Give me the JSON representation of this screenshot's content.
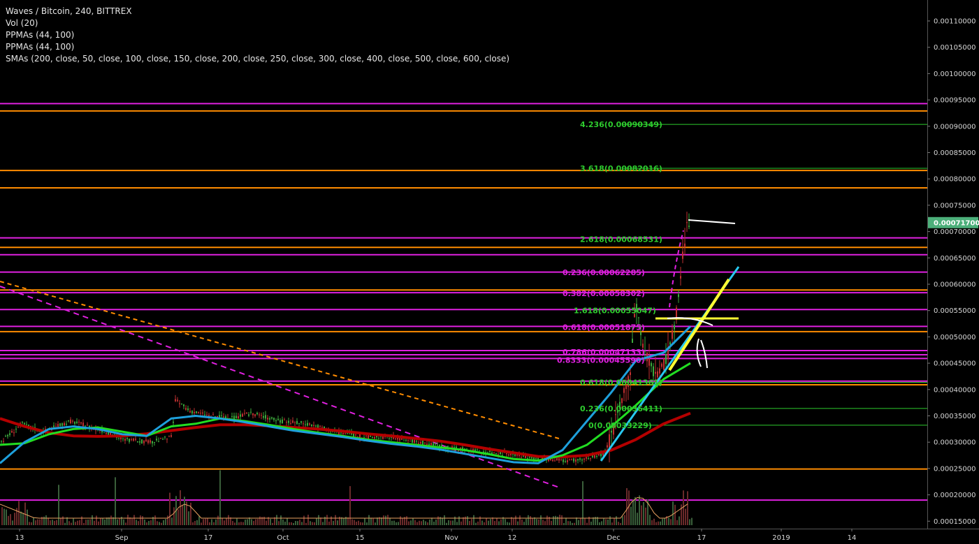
{
  "legend": {
    "title": "Waves / Bitcoin, 240, BITTREX",
    "vol": "Vol (20)",
    "ppma1": "PPMAs (44, 100)",
    "ppma2": "PPMAs (44, 100)",
    "smas": "SMAs (200, close, 50, close, 100, close, 150, close, 200, close, 250, close, 300, close, 400, close, 500, close, 600, close)"
  },
  "last_price": "0.00071700",
  "colors": {
    "orange": "#ff8c00",
    "magenta": "#e020e0",
    "fib_green": "#2ecc2e",
    "sma_red": "#b40000",
    "sma_green": "#22dd22",
    "sma_blue": "#1ea0dc",
    "trend_cyan": "#28c8f0",
    "trend_yellow": "#ffff33",
    "last_price_bg": "#4caf7a"
  },
  "chart_data": {
    "type": "line",
    "symbol": "Waves / Bitcoin",
    "interval": "240",
    "exchange": "BITTREX",
    "y_axis": {
      "ticks": [
        "0.00110000",
        "0.00105000",
        "0.00100000",
        "0.00095000",
        "0.00090000",
        "0.00085000",
        "0.00080000",
        "0.00075000",
        "0.00070000",
        "0.00065000",
        "0.00060000",
        "0.00055000",
        "0.00050000",
        "0.00045000",
        "0.00040000",
        "0.00035000",
        "0.00030000",
        "0.00025000",
        "0.00020000",
        "0.00015000"
      ],
      "ylim": [
        0.000125,
        0.00113
      ]
    },
    "x_axis": {
      "ticks": [
        "13",
        "Sep",
        "17",
        "Oct",
        "15",
        "Nov",
        "12",
        "Dec",
        "17",
        "2019",
        "14"
      ]
    },
    "horizontal_levels": [
      {
        "price": 0.000943,
        "color": "magenta"
      },
      {
        "price": 0.000929,
        "color": "orange"
      },
      {
        "price": 0.000816,
        "color": "orange"
      },
      {
        "price": 0.000783,
        "color": "orange"
      },
      {
        "price": 0.000688,
        "color": "magenta"
      },
      {
        "price": 0.00067,
        "color": "orange"
      },
      {
        "price": 0.000656,
        "color": "magenta"
      },
      {
        "price": 0.000623,
        "color": "magenta"
      },
      {
        "price": 0.000589,
        "color": "orange"
      },
      {
        "price": 0.000584,
        "color": "magenta"
      },
      {
        "price": 0.000552,
        "color": "magenta"
      },
      {
        "price": 0.00052,
        "color": "magenta"
      },
      {
        "price": 0.00051,
        "color": "orange"
      },
      {
        "price": 0.000474,
        "color": "magenta"
      },
      {
        "price": 0.000466,
        "color": "magenta"
      },
      {
        "price": 0.000459,
        "color": "magenta"
      },
      {
        "price": 0.000416,
        "color": "magenta"
      },
      {
        "price": 0.000409,
        "color": "orange"
      },
      {
        "price": 0.000249,
        "color": "orange"
      },
      {
        "price": 0.00019,
        "color": "magenta"
      }
    ],
    "fib_labels": [
      {
        "text": "4.236(0.00090349)",
        "price": 0.00090349,
        "color": "fib_green"
      },
      {
        "text": "3.618(0.00082016)",
        "price": 0.00082016,
        "color": "fib_green"
      },
      {
        "text": "2.618(0.00068531)",
        "price": 0.00068531,
        "color": "fib_green"
      },
      {
        "text": "0.236(0.00062285)",
        "price": 0.00062285,
        "color": "magenta"
      },
      {
        "text": "0.382(0.00058302)",
        "price": 0.00058302,
        "color": "magenta"
      },
      {
        "text": "1.618(0.00055047)",
        "price": 0.00055047,
        "color": "fib_green"
      },
      {
        "text": "0.618(0.00051875)",
        "price": 0.00051875,
        "color": "magenta"
      },
      {
        "text": "0.786(0.00047133)",
        "price": 0.00047133,
        "color": "magenta"
      },
      {
        "text": "0.8333(0.00045590)",
        "price": 0.0004559,
        "color": "magenta"
      },
      {
        "text": "0.618(0.00041361)",
        "price": 0.00041361,
        "color": "fib_green"
      },
      {
        "text": "0.236(0.00036411)",
        "price": 0.00036411,
        "color": "fib_green"
      },
      {
        "text": "0(0.00033229)",
        "price": 0.00033229,
        "color": "fib_green"
      }
    ],
    "series": [
      {
        "name": "SMA 200",
        "color": "sma_red",
        "values": [
          0.000345,
          0.00033,
          0.000318,
          0.000312,
          0.000311,
          0.000312,
          0.000316,
          0.000322,
          0.000328,
          0.000333,
          0.000333,
          0.000331,
          0.000328,
          0.000325,
          0.000321,
          0.000316,
          0.000312,
          0.000307,
          0.000302,
          0.000295,
          0.000287,
          0.00028,
          0.000273,
          0.000272,
          0.000275,
          0.000285,
          0.000305,
          0.000335,
          0.000355
        ]
      },
      {
        "name": "SMA 50",
        "color": "sma_green",
        "values": [
          0.000295,
          0.000298,
          0.000315,
          0.000325,
          0.000328,
          0.00032,
          0.000312,
          0.00033,
          0.000335,
          0.000345,
          0.00034,
          0.000333,
          0.000325,
          0.000318,
          0.000312,
          0.000305,
          0.0003,
          0.000295,
          0.00029,
          0.000285,
          0.000277,
          0.000268,
          0.000265,
          0.000275,
          0.000295,
          0.00033,
          0.00037,
          0.00042,
          0.00045
        ]
      },
      {
        "name": "SMA 100",
        "color": "sma_blue",
        "values": [
          0.00026,
          0.0003,
          0.000325,
          0.00033,
          0.000325,
          0.000315,
          0.000312,
          0.000345,
          0.00035,
          0.000345,
          0.000338,
          0.00033,
          0.000322,
          0.000316,
          0.00031,
          0.000303,
          0.000297,
          0.000292,
          0.000286,
          0.000278,
          0.00027,
          0.000262,
          0.00026,
          0.000285,
          0.00034,
          0.000395,
          0.000455,
          0.00047,
          0.00052
        ]
      }
    ]
  }
}
